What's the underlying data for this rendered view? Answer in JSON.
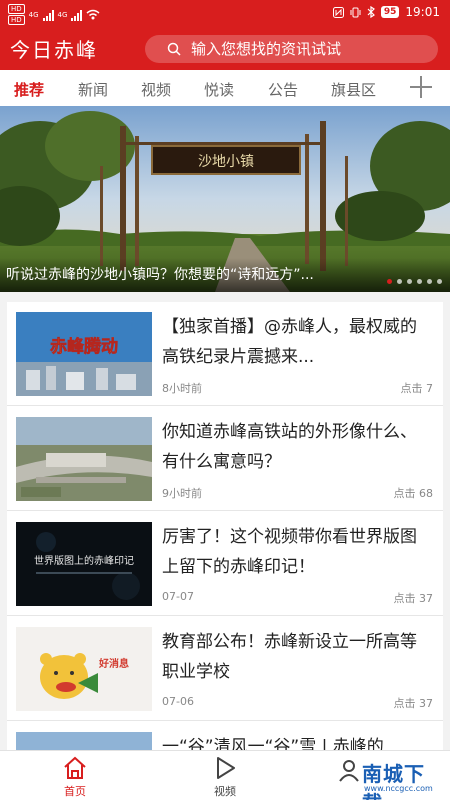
{
  "status_bar": {
    "time": "19:01",
    "battery": "95",
    "hd1": "HD",
    "hd2": "HD",
    "net1": "4G",
    "net2": "4G"
  },
  "header": {
    "logo": "今日赤峰",
    "search_placeholder": "输入您想找的资讯试试"
  },
  "tabs": [
    {
      "label": "推荐",
      "active": true
    },
    {
      "label": "新闻"
    },
    {
      "label": "视频"
    },
    {
      "label": "悦读"
    },
    {
      "label": "公告"
    },
    {
      "label": "旗县区"
    }
  ],
  "banner": {
    "title": "听说过赤峰的沙地小镇吗？你想要的“诗和远方”...",
    "sign_text": "沙地小镇",
    "slide_count": 6,
    "active_slide": 1
  },
  "news": [
    {
      "title": "【独家首播】@赤峰人，最权威的高铁纪录片震撼来...",
      "time": "8小时前",
      "views": "点击 7",
      "thumb_text": "赤峰腾动"
    },
    {
      "title": "你知道赤峰高铁站的外形像什么、有什么寓意吗？",
      "time": "9小时前",
      "views": "点击 68",
      "thumb_text": ""
    },
    {
      "title": "厉害了！这个视频带你看世界版图上留下的赤峰印记！",
      "time": "07-07",
      "views": "点击 37",
      "thumb_text": "世界版图上的赤峰印记"
    },
    {
      "title": "教育部公布！赤峰新设立一所高等职业学校",
      "time": "07-06",
      "views": "点击 37",
      "thumb_text": "好消息"
    },
    {
      "title": "一“谷”清风一“谷”雪 | 赤峰的",
      "time": "",
      "views": "",
      "thumb_text": ""
    }
  ],
  "bottom_nav": {
    "home_label": "首页",
    "video_label": "视频"
  },
  "watermark": {
    "text": "南城下载",
    "url": "www.nccgcc.com"
  },
  "colors": {
    "brand_red": "#d81e1e"
  }
}
